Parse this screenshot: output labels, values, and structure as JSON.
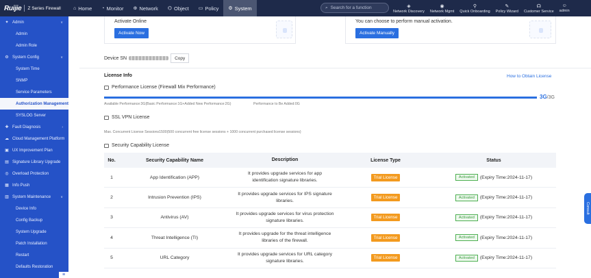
{
  "header": {
    "logo": "Ruijie",
    "product": "Z Series Firewall",
    "nav": [
      {
        "icon": "home-icon",
        "glyph": "⌂",
        "label": "Home",
        "active": false
      },
      {
        "icon": "monitor-icon",
        "glyph": "◔",
        "label": "Monitor",
        "active": false
      },
      {
        "icon": "network-icon",
        "glyph": "⊕",
        "label": "Network",
        "active": false
      },
      {
        "icon": "object-icon",
        "glyph": "⌬",
        "label": "Object",
        "active": false
      },
      {
        "icon": "policy-icon",
        "glyph": "▭",
        "label": "Policy",
        "active": false
      },
      {
        "icon": "system-icon",
        "glyph": "⚙",
        "label": "System",
        "active": true
      }
    ],
    "search_placeholder": "Search for a function",
    "tools": [
      {
        "icon": "network-discovery-icon",
        "glyph": "◈",
        "label": "Network Discovery"
      },
      {
        "icon": "network-mgmt-icon",
        "glyph": "◉",
        "label": "Network Mgmt"
      },
      {
        "icon": "quick-onboarding-icon",
        "glyph": "⚲",
        "label": "Quick Onboarding"
      },
      {
        "icon": "policy-wizard-icon",
        "glyph": "✎",
        "label": "Policy Wizard"
      },
      {
        "icon": "customer-service-icon",
        "glyph": "☊",
        "label": "Customer Service"
      },
      {
        "icon": "user-icon",
        "glyph": "☺",
        "label": "admin"
      }
    ]
  },
  "sidebar": {
    "items": [
      {
        "label": "Admin",
        "level": "top",
        "icon": "admin-icon",
        "glyph": "✦",
        "chev": "∨"
      },
      {
        "label": "Admin",
        "level": "sub"
      },
      {
        "label": "Admin Role",
        "level": "sub"
      },
      {
        "label": "System Config",
        "level": "top",
        "icon": "system-config-icon",
        "glyph": "⚙",
        "chev": "∨"
      },
      {
        "label": "System Time",
        "level": "sub"
      },
      {
        "label": "SNMP",
        "level": "sub"
      },
      {
        "label": "Service Parameters",
        "level": "sub"
      },
      {
        "label": "Authorization Management",
        "level": "sub",
        "active": true
      },
      {
        "label": "SYSLOG Server",
        "level": "sub"
      },
      {
        "label": "Fault Diagnosis",
        "level": "top",
        "icon": "fault-diagnosis-icon",
        "glyph": "✚",
        "chev": "›"
      },
      {
        "label": "Cloud Management Platform",
        "level": "top",
        "icon": "cloud-icon",
        "glyph": "☁"
      },
      {
        "label": "UX Improvement Plan",
        "level": "top",
        "icon": "ux-icon",
        "glyph": "▣"
      },
      {
        "label": "Signature Library Upgrade",
        "level": "top",
        "icon": "signature-icon",
        "glyph": "▤"
      },
      {
        "label": "Overload Protection",
        "level": "top",
        "icon": "overload-icon",
        "glyph": "◎"
      },
      {
        "label": "Info Push",
        "level": "top",
        "icon": "info-push-icon",
        "glyph": "▦"
      },
      {
        "label": "System Maintenance",
        "level": "top",
        "icon": "maintenance-icon",
        "glyph": "▥",
        "chev": "∨"
      },
      {
        "label": "Device Info",
        "level": "sub"
      },
      {
        "label": "Config Backup",
        "level": "sub"
      },
      {
        "label": "System Upgrade",
        "level": "sub"
      },
      {
        "label": "Patch Installation",
        "level": "sub"
      },
      {
        "label": "Restart",
        "level": "sub"
      },
      {
        "label": "Defaults Restoration",
        "level": "sub"
      }
    ],
    "collapse_glyph": "≡"
  },
  "activation": {
    "online_title": "Activate Online",
    "online_button": "Activate Now",
    "manual_text": "You can choose to perform manual activation.",
    "manual_button": "Activate Manually"
  },
  "device": {
    "sn_label": "Device SN",
    "copy_button": "Copy"
  },
  "license_info": {
    "title": "License Info",
    "obtain_link": "How to Obtain License",
    "performance": {
      "title": "Performance License (Firewall Mix Performance)",
      "used": "3G",
      "total": "3G",
      "fraction": 1.0,
      "available_text": "Available Performance:3G(Basic Performance:1G+Added New Performance:2G)",
      "to_be_added_text": "Performance to Be Added:0G"
    },
    "ssl_vpn": {
      "title": "SSL VPN License",
      "text": "Max. Concurrent License Sessions1500(500 concurrent free license sessions + 1000 concurrent purchased license sessions)"
    },
    "security": {
      "title": "Security Capability License",
      "columns": [
        "No.",
        "Security Capability Name",
        "Description",
        "License Type",
        "Status"
      ],
      "rows": [
        {
          "no": "1",
          "name": "App Identification (APP)",
          "desc1": "It provides upgrade services for app",
          "desc2": "identification signature libraries.",
          "type": "Trial License",
          "status": "Activated",
          "expiry": "(Expiry Time:2024-11-17)"
        },
        {
          "no": "2",
          "name": "Intrusion Prevention (IPS)",
          "desc1": "It provides upgrade services for IPS signature",
          "desc2": "libraries.",
          "type": "Trial License",
          "status": "Activated",
          "expiry": "(Expiry Time:2024-11-17)"
        },
        {
          "no": "3",
          "name": "Antivirus (AV)",
          "desc1": "It provides upgrade services for virus protection",
          "desc2": "signature libraries.",
          "type": "Trial License",
          "status": "Activated",
          "expiry": "(Expiry Time:2024-11-17)"
        },
        {
          "no": "4",
          "name": "Threat Intelligence (TI)",
          "desc1": "It provides upgrade for the threat intelligence",
          "desc2": "libraries of the firewall.",
          "type": "Trial License",
          "status": "Activated",
          "expiry": "(Expiry Time:2024-11-17)"
        },
        {
          "no": "5",
          "name": "URL Category",
          "desc1": "It provides upgrade services for URL category",
          "desc2": "signature libraries.",
          "type": "Trial License",
          "status": "Activated",
          "expiry": "(Expiry Time:2024-11-17)"
        }
      ]
    }
  },
  "side_tab": "Consult"
}
